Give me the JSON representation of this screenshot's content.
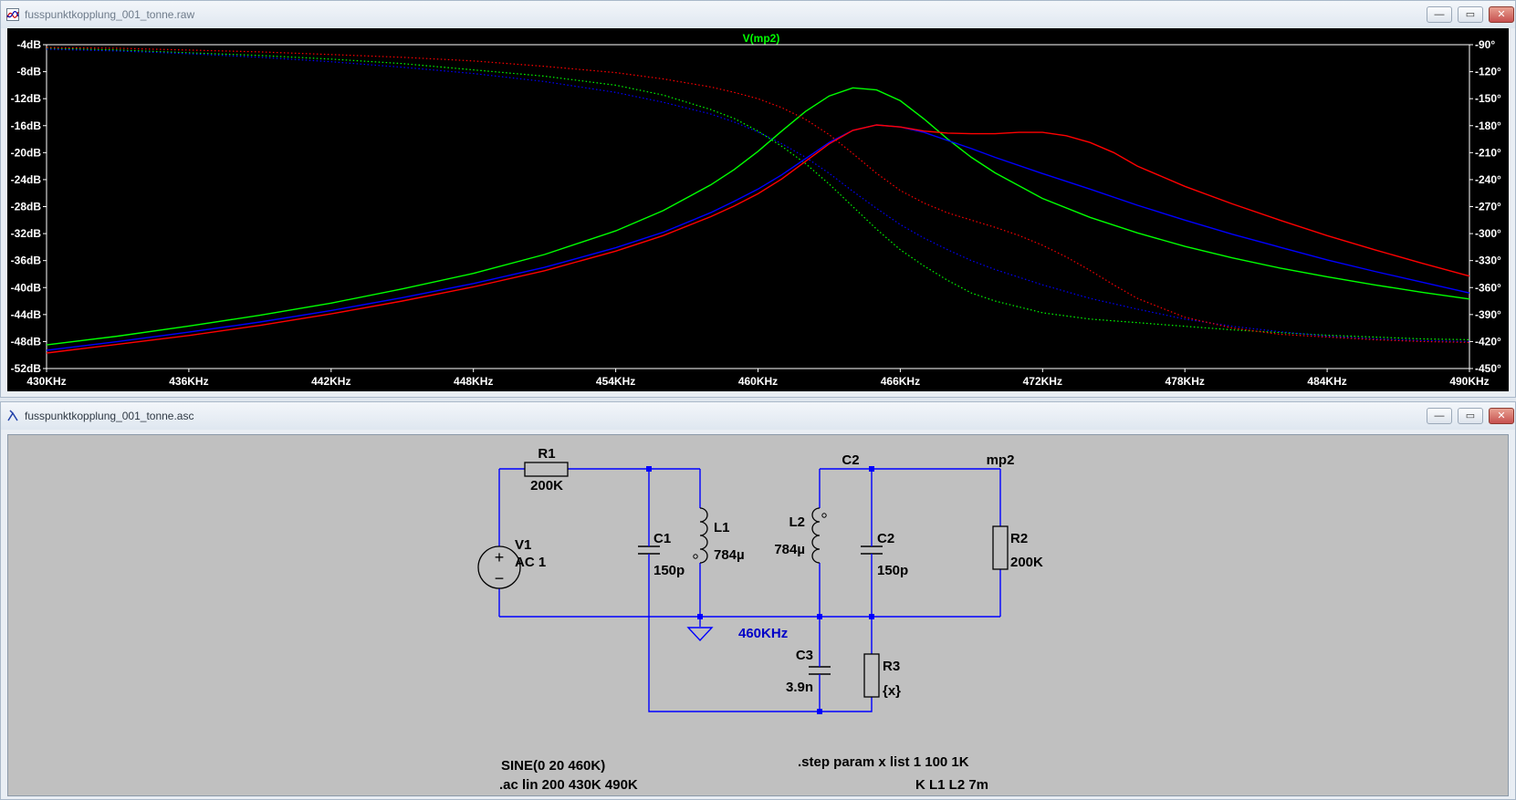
{
  "plot_window": {
    "title": "fusspunktkopplung_001_tonne.raw",
    "trace_label": "V(mp2)",
    "icon": "waveform-icon",
    "min_glyph": "—",
    "max_glyph": "▭",
    "close_glyph": "✕"
  },
  "schematic_window": {
    "title": "fusspunktkopplung_001_tonne.asc",
    "icon": "schematic-icon",
    "min_glyph": "—",
    "max_glyph": "▭",
    "close_glyph": "✕"
  },
  "chart_data": {
    "type": "line",
    "title": "V(mp2)",
    "x_ticks": [
      "430KHz",
      "436KHz",
      "442KHz",
      "448KHz",
      "454KHz",
      "460KHz",
      "466KHz",
      "472KHz",
      "478KHz",
      "484KHz",
      "490KHz"
    ],
    "y_left_ticks": [
      "-4dB",
      "-8dB",
      "-12dB",
      "-16dB",
      "-20dB",
      "-24dB",
      "-28dB",
      "-32dB",
      "-36dB",
      "-40dB",
      "-44dB",
      "-48dB",
      "-52dB"
    ],
    "y_right_ticks": [
      "-90°",
      "-120°",
      "-150°",
      "-180°",
      "-210°",
      "-240°",
      "-270°",
      "-300°",
      "-330°",
      "-360°",
      "-390°",
      "-420°",
      "-450°"
    ],
    "xlim_khz": [
      430,
      490
    ],
    "ylim_db": [
      -52,
      -4
    ],
    "ylim_deg": [
      -450,
      -90
    ],
    "grid": false,
    "background": "#000000",
    "series": [
      {
        "color": "#00ff00",
        "x_khz": [
          430,
          433,
          436,
          439,
          442,
          445,
          448,
          451,
          454,
          456,
          458,
          459,
          460,
          461,
          462,
          463,
          464,
          465,
          466,
          467,
          468,
          469,
          470,
          472,
          474,
          476,
          478,
          480,
          482,
          484,
          486,
          488,
          490
        ],
        "mag_db": [
          -48.5,
          -47.2,
          -45.7,
          -44.1,
          -42.3,
          -40.2,
          -37.9,
          -35.1,
          -31.6,
          -28.6,
          -24.8,
          -22.5,
          -19.8,
          -16.8,
          -13.9,
          -11.6,
          -10.4,
          -10.7,
          -12.3,
          -15.0,
          -18.0,
          -20.7,
          -23.0,
          -26.8,
          -29.6,
          -31.9,
          -33.9,
          -35.6,
          -37.1,
          -38.4,
          -39.6,
          -40.7,
          -41.7
        ],
        "phase_deg": [
          -94,
          -96,
          -99,
          -102,
          -106,
          -111,
          -118,
          -125,
          -135,
          -146,
          -162,
          -172,
          -186,
          -203,
          -222,
          -245,
          -270,
          -295,
          -318,
          -336,
          -352,
          -366,
          -375,
          -388,
          -395,
          -399,
          -403,
          -407,
          -410,
          -413,
          -415,
          -417,
          -418
        ]
      },
      {
        "color": "#0000ff",
        "x_khz": [
          430,
          433,
          436,
          439,
          442,
          445,
          448,
          451,
          454,
          456,
          458,
          459,
          460,
          461,
          462,
          463,
          464,
          465,
          466,
          467,
          468,
          469,
          470,
          472,
          474,
          476,
          478,
          480,
          482,
          484,
          486,
          488,
          490
        ],
        "mag_db": [
          -49.3,
          -48.0,
          -46.6,
          -45.1,
          -43.4,
          -41.5,
          -39.4,
          -37.0,
          -34.1,
          -31.8,
          -28.9,
          -27.2,
          -25.4,
          -23.3,
          -20.9,
          -18.5,
          -16.7,
          -15.9,
          -16.2,
          -17.0,
          -18.2,
          -19.4,
          -20.7,
          -23.1,
          -25.4,
          -27.8,
          -30.0,
          -32.1,
          -34.0,
          -35.9,
          -37.6,
          -39.2,
          -40.8
        ],
        "phase_deg": [
          -95,
          -97,
          -100,
          -104,
          -109,
          -115,
          -122,
          -131,
          -143,
          -154,
          -167,
          -176,
          -187,
          -200,
          -215,
          -233,
          -253,
          -272,
          -290,
          -305,
          -318,
          -330,
          -340,
          -357,
          -372,
          -384,
          -395,
          -403,
          -409,
          -414,
          -417,
          -419,
          -420
        ]
      },
      {
        "color": "#ff0000",
        "x_khz": [
          430,
          433,
          436,
          439,
          442,
          445,
          448,
          451,
          454,
          456,
          458,
          459,
          460,
          461,
          462,
          463,
          464,
          465,
          466,
          467,
          468,
          469,
          470,
          471,
          472,
          473,
          474,
          475,
          476,
          478,
          480,
          482,
          484,
          486,
          488,
          490
        ],
        "mag_db": [
          -49.7,
          -48.4,
          -47.1,
          -45.6,
          -43.9,
          -42.0,
          -39.9,
          -37.5,
          -34.6,
          -32.3,
          -29.5,
          -27.9,
          -26.1,
          -23.9,
          -21.3,
          -18.7,
          -16.7,
          -15.9,
          -16.2,
          -16.8,
          -17.1,
          -17.2,
          -17.2,
          -17.0,
          -17.0,
          -17.5,
          -18.5,
          -20.0,
          -22.0,
          -25.0,
          -27.6,
          -30.0,
          -32.3,
          -34.4,
          -36.4,
          -38.3
        ],
        "phase_deg": [
          -93,
          -94,
          -96,
          -98,
          -101,
          -104,
          -108,
          -114,
          -121,
          -128,
          -137,
          -143,
          -150,
          -160,
          -173,
          -190,
          -211,
          -233,
          -252,
          -266,
          -277,
          -285,
          -293,
          -302,
          -313,
          -326,
          -341,
          -357,
          -372,
          -393,
          -405,
          -412,
          -415,
          -418,
          -420,
          -421
        ]
      }
    ]
  },
  "schematic": {
    "bg": "#c0c0c0",
    "wire_color": "#0000ff",
    "components": {
      "r1": {
        "name": "R1",
        "value": "200K"
      },
      "v1": {
        "name": "V1",
        "value": "AC 1"
      },
      "c1": {
        "name": "C1",
        "value": "150p"
      },
      "l1": {
        "name": "L1",
        "value": "784µ"
      },
      "l2": {
        "name": "L2",
        "value": "784µ"
      },
      "c2": {
        "name": "C2",
        "value": "150p"
      },
      "r2": {
        "name": "R2",
        "value": "200K"
      },
      "c3": {
        "name": "C3",
        "value": "3.9n"
      },
      "r3": {
        "name": "R3",
        "value": "{x}"
      }
    },
    "net_c2": "C2",
    "net_mp2": "mp2",
    "freq_label": "460KHz",
    "directives": {
      "sine": "SINE(0 20 460K)",
      "ac": ".ac lin 200 430K 490K",
      "step": ".step param x list 1 100 1K",
      "coupling": "K L1 L2 7m"
    }
  }
}
